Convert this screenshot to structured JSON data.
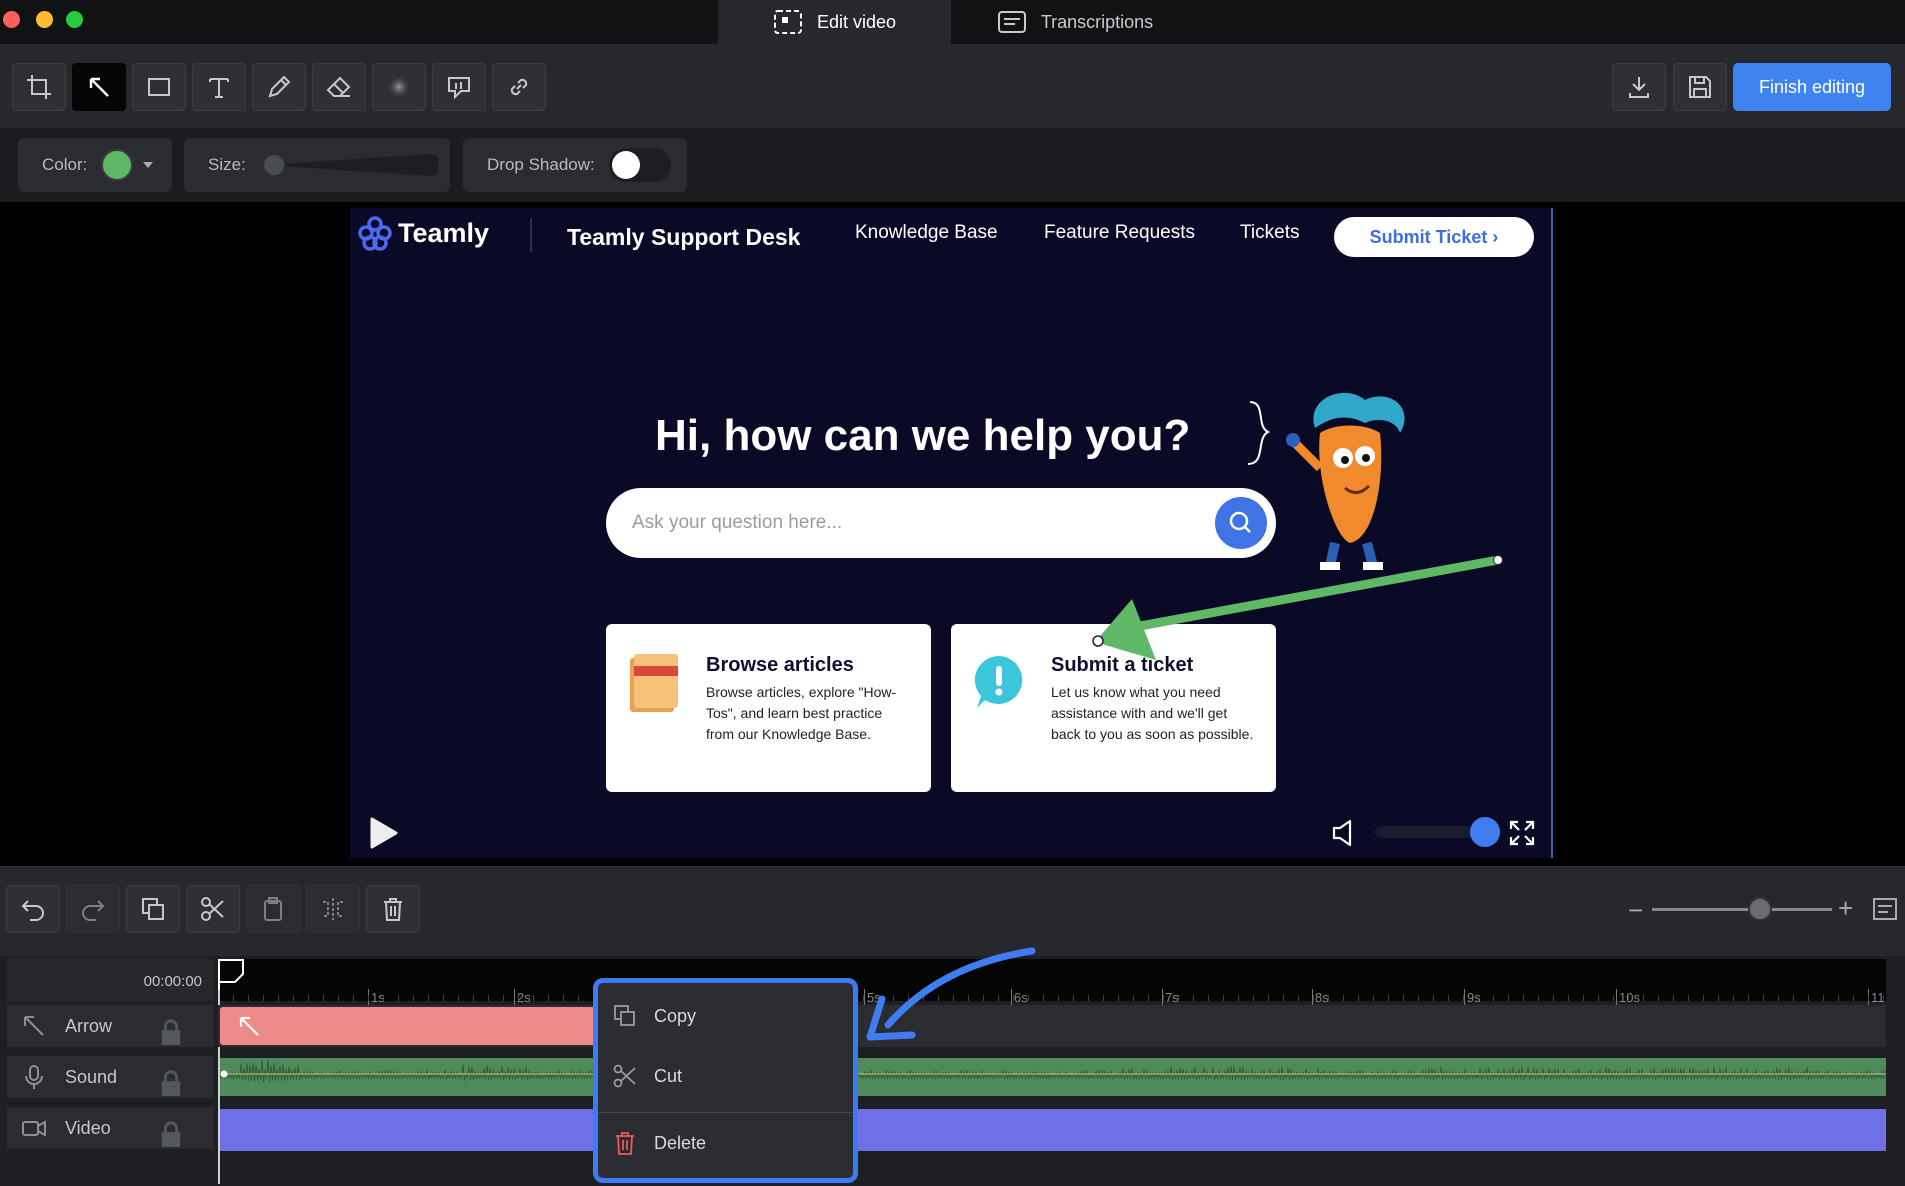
{
  "window": {
    "tabs": [
      {
        "label": "Edit video",
        "icon": "screen-record-icon",
        "active": true
      },
      {
        "label": "Transcriptions",
        "icon": "transcript-icon",
        "active": false
      }
    ]
  },
  "toolbar": {
    "tools": [
      "crop-icon",
      "arrow-tool-icon",
      "rectangle-icon",
      "text-icon",
      "pencil-icon",
      "eraser-icon",
      "blur-icon",
      "callout-icon",
      "link-icon"
    ],
    "finish_label": "Finish editing"
  },
  "properties": {
    "color_label": "Color:",
    "color_value": "#5fb865",
    "size_label": "Size:",
    "shadow_label": "Drop Shadow:"
  },
  "video": {
    "logo_text": "Teamly",
    "site_title": "Teamly Support Desk",
    "nav": [
      "Knowledge Base",
      "Feature Requests",
      "Tickets"
    ],
    "cta_label": "Submit Ticket ›",
    "hero_title": "Hi, how can we help you?",
    "search_placeholder": "Ask your question here...",
    "cards": [
      {
        "title": "Browse articles",
        "text": "Browse articles, explore \"How-Tos\", and learn best practice from our Knowledge Base."
      },
      {
        "title": "Submit a ticket",
        "text": "Let us know what you need assistance with and we'll get back to you as soon as possible."
      }
    ],
    "volume_level": 1.0
  },
  "timeline": {
    "timecode": "00:00:00",
    "ruler": [
      "1s",
      "2s",
      "5s",
      "6s",
      "7s",
      "8s",
      "9s",
      "10s",
      "11"
    ],
    "tracks": [
      {
        "label": "Arrow",
        "icon": "arrow-icon"
      },
      {
        "label": "Sound",
        "icon": "microphone-icon"
      },
      {
        "label": "Video",
        "icon": "video-camera-icon"
      }
    ],
    "zoom_level": 0.6
  },
  "context_menu": {
    "copy": "Copy",
    "cut": "Cut",
    "delete": "Delete"
  },
  "colors": {
    "accent": "#3f83f0",
    "arrow_track": "#ee8a87",
    "sound_track": "#4f8a5a",
    "video_track": "#7070e6",
    "annotation_arrow": "#5fb865"
  }
}
